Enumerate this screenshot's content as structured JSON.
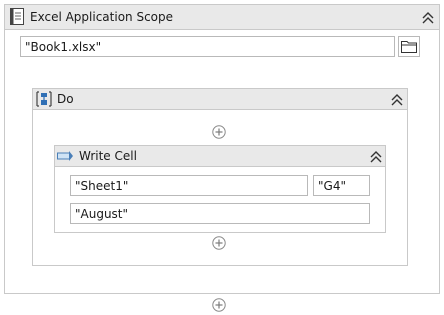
{
  "scope": {
    "title": "Excel Application Scope",
    "workbook_path": "\"Book1.xlsx\"",
    "icons": {
      "activity": "excel-scope-icon",
      "browse": "folder-icon",
      "collapse": "double-chevron-up-icon"
    }
  },
  "sequence": {
    "title": "Do",
    "icons": {
      "activity": "sequence-icon",
      "collapse": "double-chevron-up-icon",
      "add": "add-circle-icon"
    }
  },
  "write_cell": {
    "title": "Write Cell",
    "sheet_name": "\"Sheet1\"",
    "cell": "\"G4\"",
    "value": "\"August\"",
    "icons": {
      "activity": "write-cell-icon",
      "collapse": "double-chevron-up-icon"
    }
  }
}
